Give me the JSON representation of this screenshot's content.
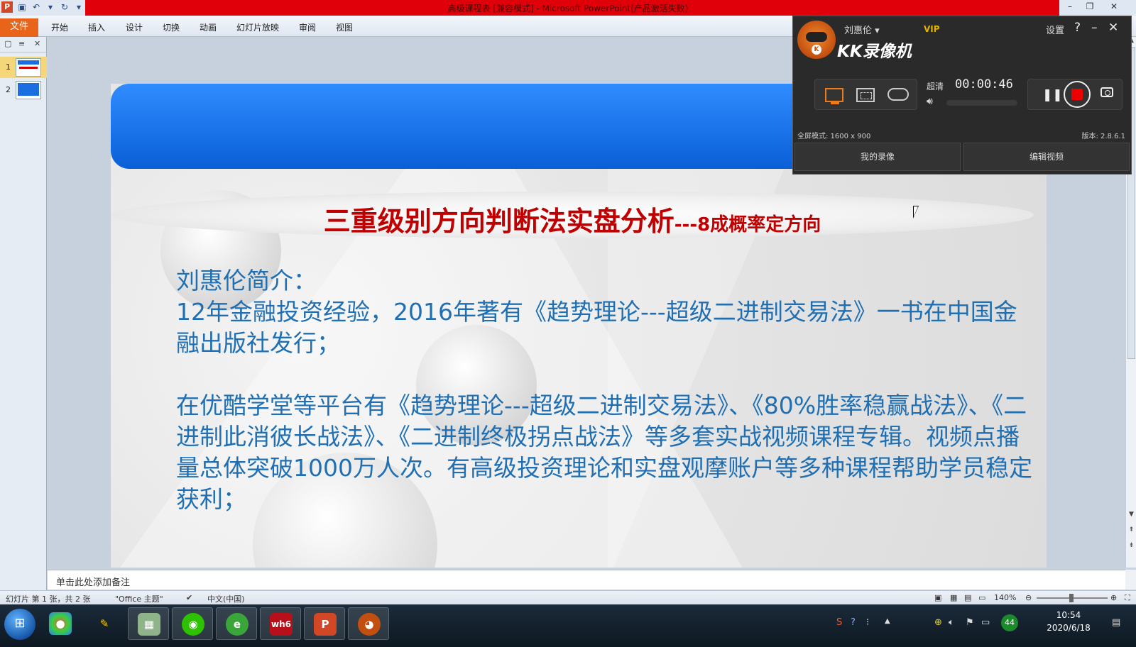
{
  "window": {
    "title": "高级课程表 [兼容模式] - Microsoft PowerPoint(产品激活失败)"
  },
  "ribbon": {
    "file_label": "文件",
    "tabs": [
      "开始",
      "插入",
      "设计",
      "切换",
      "动画",
      "幻灯片放映",
      "审阅",
      "视图"
    ]
  },
  "thumbnails": [
    {
      "number": "1",
      "selected": true
    },
    {
      "number": "2",
      "selected": false
    }
  ],
  "slide": {
    "title_main": "三重级别方向判断法实盘分析",
    "title_sub": "---8成概率定方向",
    "intro_heading": "刘惠伦简介：",
    "intro_line1": "12年金融投资经验，2016年著有《趋势理论---超级二进制交易法》一书在中国金融出版社发行；",
    "intro_line2": "在优酷学堂等平台有《趋势理论---超级二进制交易法》、《80%胜率稳赢战法》、《二进制此消彼长战法》、《二进制终极拐点战法》等多套实战视频课程专辑。视频点播量总体突破1000万人次。有高级投资理论和实盘观摩账户等多种课程帮助学员稳定获利；"
  },
  "notes": {
    "placeholder": "单击此处添加备注"
  },
  "status": {
    "slide_info": "幻灯片 第 1 张，共 2 张",
    "theme": "\"Office 主题\"",
    "language": "中文(中国)",
    "zoom": "140%"
  },
  "kk_recorder": {
    "user": "刘惠伦",
    "vip": "VIP",
    "brand": "KK录像机",
    "settings_label": "设置",
    "quality": "超清",
    "elapsed": "00:00:46",
    "mode_text": "全屏模式: 1600 x 900",
    "version_text": "版本: 2.8.6.1",
    "my_videos_label": "我的录像",
    "edit_video_label": "编辑视频"
  },
  "taskbar": {
    "time": "10:54",
    "date": "2020/6/18",
    "badge": "44"
  },
  "colors": {
    "title_red": "#e0000a",
    "file_tab": "#e8641b",
    "banner_blue": "#1a74ee",
    "slide_title_red": "#c00000",
    "slide_body_blue": "#1f6fb2",
    "kk_accent": "#f07a1a"
  }
}
